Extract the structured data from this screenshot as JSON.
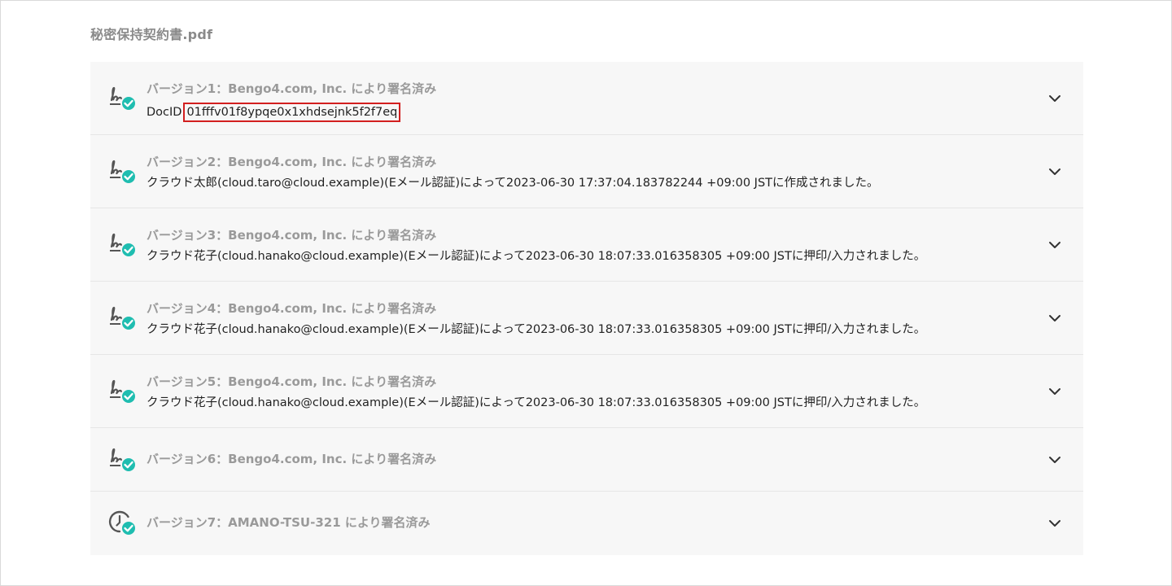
{
  "document": {
    "title": "秘密保持契約書.pdf"
  },
  "versions": [
    {
      "label": "バージョン1：Bengo4.com, Inc. により署名済み",
      "detail_prefix": "DocID",
      "detail_value": "01fffv01f8ypqe0x1xhdsejnk5f2f7eq",
      "icon": "signature-verified-icon"
    },
    {
      "label": "バージョン2：Bengo4.com, Inc. により署名済み",
      "detail": "クラウド太郎(cloud.taro@cloud.example)(Eメール認証)によって2023-06-30 17:37:04.183782244 +09:00 JSTに作成されました。",
      "icon": "signature-verified-icon"
    },
    {
      "label": "バージョン3：Bengo4.com, Inc. により署名済み",
      "detail": "クラウド花子(cloud.hanako@cloud.example)(Eメール認証)によって2023-06-30 18:07:33.016358305 +09:00 JSTに押印/入力されました。",
      "icon": "signature-verified-icon"
    },
    {
      "label": "バージョン4：Bengo4.com, Inc. により署名済み",
      "detail": "クラウド花子(cloud.hanako@cloud.example)(Eメール認証)によって2023-06-30 18:07:33.016358305 +09:00 JSTに押印/入力されました。",
      "icon": "signature-verified-icon"
    },
    {
      "label": "バージョン5：Bengo4.com, Inc. により署名済み",
      "detail": "クラウド花子(cloud.hanako@cloud.example)(Eメール認証)によって2023-06-30 18:07:33.016358305 +09:00 JSTに押印/入力されました。",
      "icon": "signature-verified-icon"
    },
    {
      "label": "バージョン6：Bengo4.com, Inc. により署名済み",
      "icon": "signature-verified-icon"
    },
    {
      "label": "バージョン7：AMANO-TSU-321 により署名済み",
      "icon": "timestamp-verified-icon"
    }
  ],
  "colors": {
    "accent_teal": "#1fbdb0",
    "highlight_red": "#d21f1f",
    "icon_gray": "#555555"
  }
}
